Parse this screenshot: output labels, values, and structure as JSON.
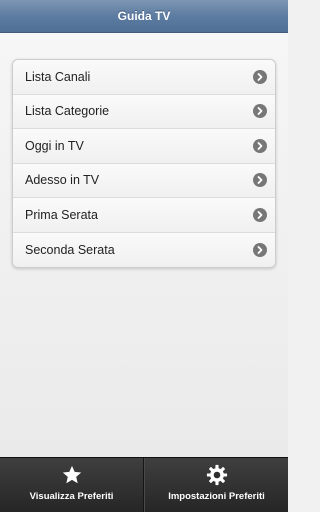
{
  "header": {
    "title": "Guida TV"
  },
  "menu": {
    "items": [
      {
        "label": "Lista Canali"
      },
      {
        "label": "Lista Categorie"
      },
      {
        "label": "Oggi in TV"
      },
      {
        "label": "Adesso in TV"
      },
      {
        "label": "Prima Serata"
      },
      {
        "label": "Seconda Serata"
      }
    ]
  },
  "footer": {
    "favorites_label": "Visualizza Preferiti",
    "favorites_icon": "star-icon",
    "settings_label": "Impostazioni Preferiti",
    "settings_icon": "gear-icon"
  },
  "colors": {
    "header": "#5d7ca1",
    "footer": "#2b2b2b",
    "chevron": "#777777"
  }
}
